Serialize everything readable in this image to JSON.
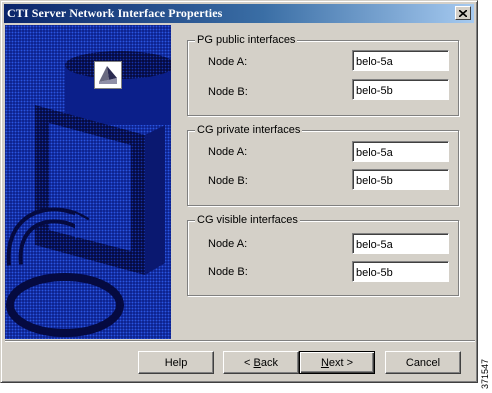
{
  "window": {
    "title": "CTI Server Network Interface Properties"
  },
  "groups": [
    {
      "legend": "PG public interfaces",
      "rows": [
        {
          "label": "Node A:",
          "value": "belo-5a"
        },
        {
          "label": "Node B:",
          "value": "belo-5b"
        }
      ]
    },
    {
      "legend": "CG private interfaces",
      "rows": [
        {
          "label": "Node A:",
          "value": "belo-5a"
        },
        {
          "label": "Node B:",
          "value": "belo-5b"
        }
      ]
    },
    {
      "legend": "CG visible interfaces",
      "rows": [
        {
          "label": "Node A:",
          "value": "belo-5a"
        },
        {
          "label": "Node B:",
          "value": "belo-5b"
        }
      ]
    }
  ],
  "buttons": {
    "help": "Help",
    "back_arrow": "< ",
    "back_accel": "B",
    "back_rest": "ack",
    "next_accel": "N",
    "next_rest": "ext >",
    "cancel": "Cancel"
  },
  "figure_id": "371547",
  "colors": {
    "titlebar": "#0a246a",
    "art_blue": "#1a3fc8",
    "face": "#d4d0c8"
  },
  "icons": {
    "close": "close-icon",
    "wizard_logo": "wizard-logo-icon"
  }
}
